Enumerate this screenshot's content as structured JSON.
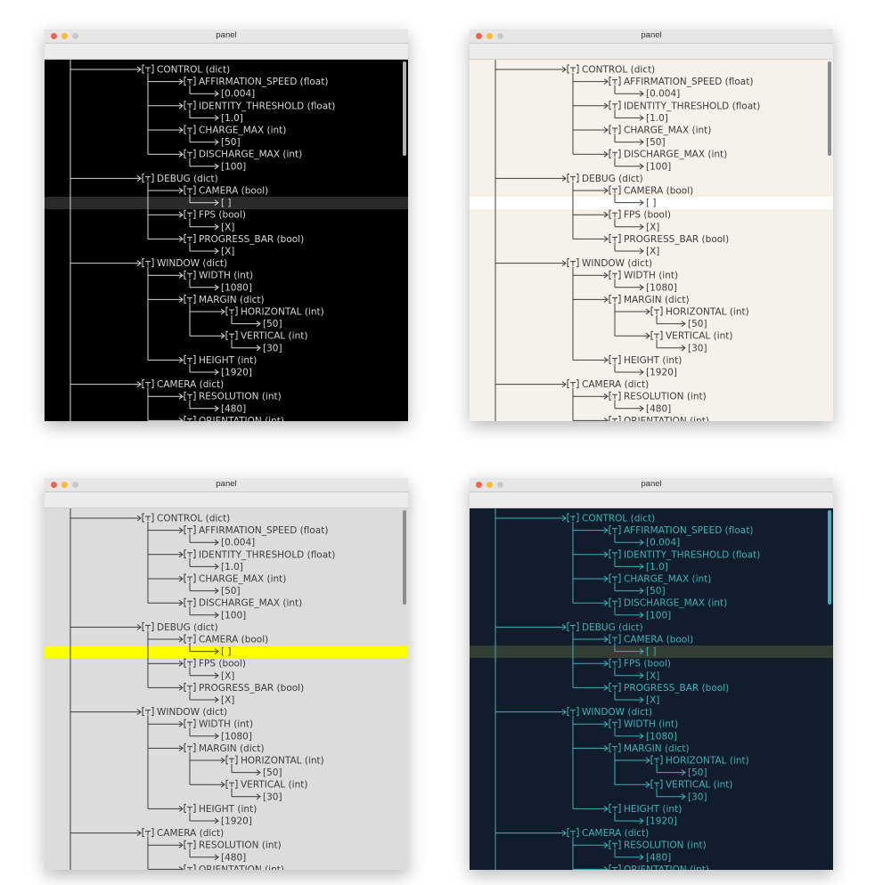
{
  "window_title": "panel",
  "themes": [
    {
      "name": "dark",
      "bg": "#000000",
      "fg": "#d6d6d6",
      "highlight": "#2a2a2a",
      "scrollbar": "#b4b4b4"
    },
    {
      "name": "cream",
      "bg": "#f8f1ea",
      "fg": "#3d3d3d",
      "highlight": "#ffffff",
      "scrollbar": "#8c8c8c"
    },
    {
      "name": "light-gray",
      "bg": "#dcdcdc",
      "fg": "#3d3d3d",
      "highlight": "#ffff00",
      "scrollbar": "#8c8c8c"
    },
    {
      "name": "navy",
      "bg": "#111d2c",
      "fg": "#3fb0b7",
      "highlight": "#323d33",
      "scrollbar": "#3fb0b7"
    }
  ],
  "tree": [
    {
      "label": "CONTROL (dict)",
      "children": [
        {
          "label": "AFFIRMATION_SPEED (float)",
          "value": "[0.004]"
        },
        {
          "label": "IDENTITY_THRESHOLD (float)",
          "value": "[1.0]"
        },
        {
          "label": "CHARGE_MAX (int)",
          "value": "[50]"
        },
        {
          "label": "DISCHARGE_MAX (int)",
          "value": "[100]"
        }
      ]
    },
    {
      "label": "DEBUG (dict)",
      "children": [
        {
          "label": "CAMERA (bool)",
          "value": "[ ]",
          "selected": true
        },
        {
          "label": "FPS (bool)",
          "value": "[X]"
        },
        {
          "label": "PROGRESS_BAR (bool)",
          "value": "[X]"
        }
      ]
    },
    {
      "label": "WINDOW (dict)",
      "children": [
        {
          "label": "WIDTH (int)",
          "value": "[1080]"
        },
        {
          "label": "MARGIN (dict)",
          "children": [
            {
              "label": "HORIZONTAL (int)",
              "value": "[50]"
            },
            {
              "label": "VERTICAL (int)",
              "value": "[30]"
            }
          ]
        },
        {
          "label": "HEIGHT (int)",
          "value": "[1920]"
        }
      ]
    },
    {
      "label": "CAMERA (dict)",
      "children": [
        {
          "label": "RESOLUTION (int)",
          "value": "[480]"
        },
        {
          "label": "ORIENTATION (int)",
          "value": ""
        }
      ]
    }
  ],
  "expander": "[−]"
}
